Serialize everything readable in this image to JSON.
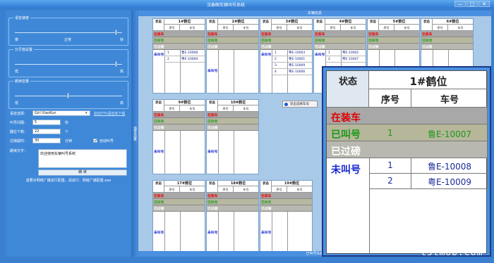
{
  "window": {
    "title": "汉泰图车辆叫号系统",
    "controls": [
      "—",
      "□",
      "✕"
    ]
  },
  "left": {
    "sliders": [
      {
        "legend": "语音速度",
        "min": "慢",
        "mid": "正常",
        "max": "快",
        "level": 0.95
      },
      {
        "legend": "分贝值设置",
        "min": "低",
        "mid": "",
        "max": "高",
        "level": 0.95
      },
      {
        "legend": "朗读音量",
        "min": "低",
        "mid": "",
        "max": "高",
        "level": 0.5
      }
    ],
    "voice_label": "语音选择：",
    "voice_value": "Girl XiaoKun",
    "voice_link": "启动TTS语音库下载",
    "call_interval_label": "叫号间隔：",
    "call_interval_value": "5",
    "call_interval_unit": "秒",
    "repeat_label": "翻位个数：",
    "repeat_value": "22",
    "repeat_unit": "个",
    "overtime_label": "过磅超时：",
    "overtime_value": "30",
    "overtime_unit": "分钟",
    "auto_call_label": "自动叫号",
    "auto_call_checked": true,
    "read_text_label": "朗读文字：",
    "read_text_value": "欢迎使用车辆叫号系统",
    "read_button": "朗 读",
    "note": "首要对网络广播进行配置，请进行：网络广播配置.exe"
  },
  "side_tab": "语音设置",
  "main": {
    "header": "车辆信息",
    "footer": "已叫号车辆",
    "col_state": "状态",
    "col_seq": "序号",
    "col_car": "车号",
    "state_loading": "在装车",
    "state_called": "已叫号",
    "state_weighed": "已过磅",
    "state_waiting": "未叫号",
    "bays": [
      {
        "name": "1#鹤位",
        "waiting": [
          {
            "seq": "1",
            "car": "鲁E-10008"
          },
          {
            "seq": "2",
            "car": "粤E-10009"
          }
        ]
      },
      {
        "name": "2#鹤位",
        "waiting": []
      },
      {
        "name": "3#鹤位",
        "waiting": [
          {
            "seq": "1",
            "car": "粤E-10003"
          },
          {
            "seq": "2",
            "car": "粤E-10001"
          },
          {
            "seq": "3",
            "car": "粤E-10009"
          },
          {
            "seq": "4",
            "car": "粤E-10006"
          }
        ]
      },
      {
        "name": "4#鹤位",
        "waiting": [
          {
            "seq": "1",
            "car": "粤E-10002"
          },
          {
            "seq": "2",
            "car": "粤E-10007"
          }
        ]
      },
      {
        "name": "5#鹤位",
        "waiting": []
      },
      {
        "name": "6#鹤位",
        "waiting": []
      },
      {
        "name": "9#鹤位",
        "waiting": []
      },
      {
        "name": "10#鹤位",
        "waiting": []
      },
      {
        "name": "17#鹤位",
        "waiting": []
      },
      {
        "name": "18#鹤位",
        "waiting": []
      },
      {
        "name": "19#鹤位",
        "waiting": []
      }
    ],
    "tooltip": "双击选择车号",
    "zoom": {
      "bay": "1#鹤位",
      "called_seq": "1",
      "called_car": "鲁E-10007",
      "waiting": [
        {
          "seq": "1",
          "car": "鲁E-10008"
        },
        {
          "seq": "2",
          "car": "粤E-10009"
        }
      ]
    }
  },
  "watermark": "tslmob.com",
  "colors": {
    "loading": "#e00000",
    "called": "#1a9a1a",
    "waiting": "#1a2ad0",
    "accent": "#3a7fd0"
  }
}
